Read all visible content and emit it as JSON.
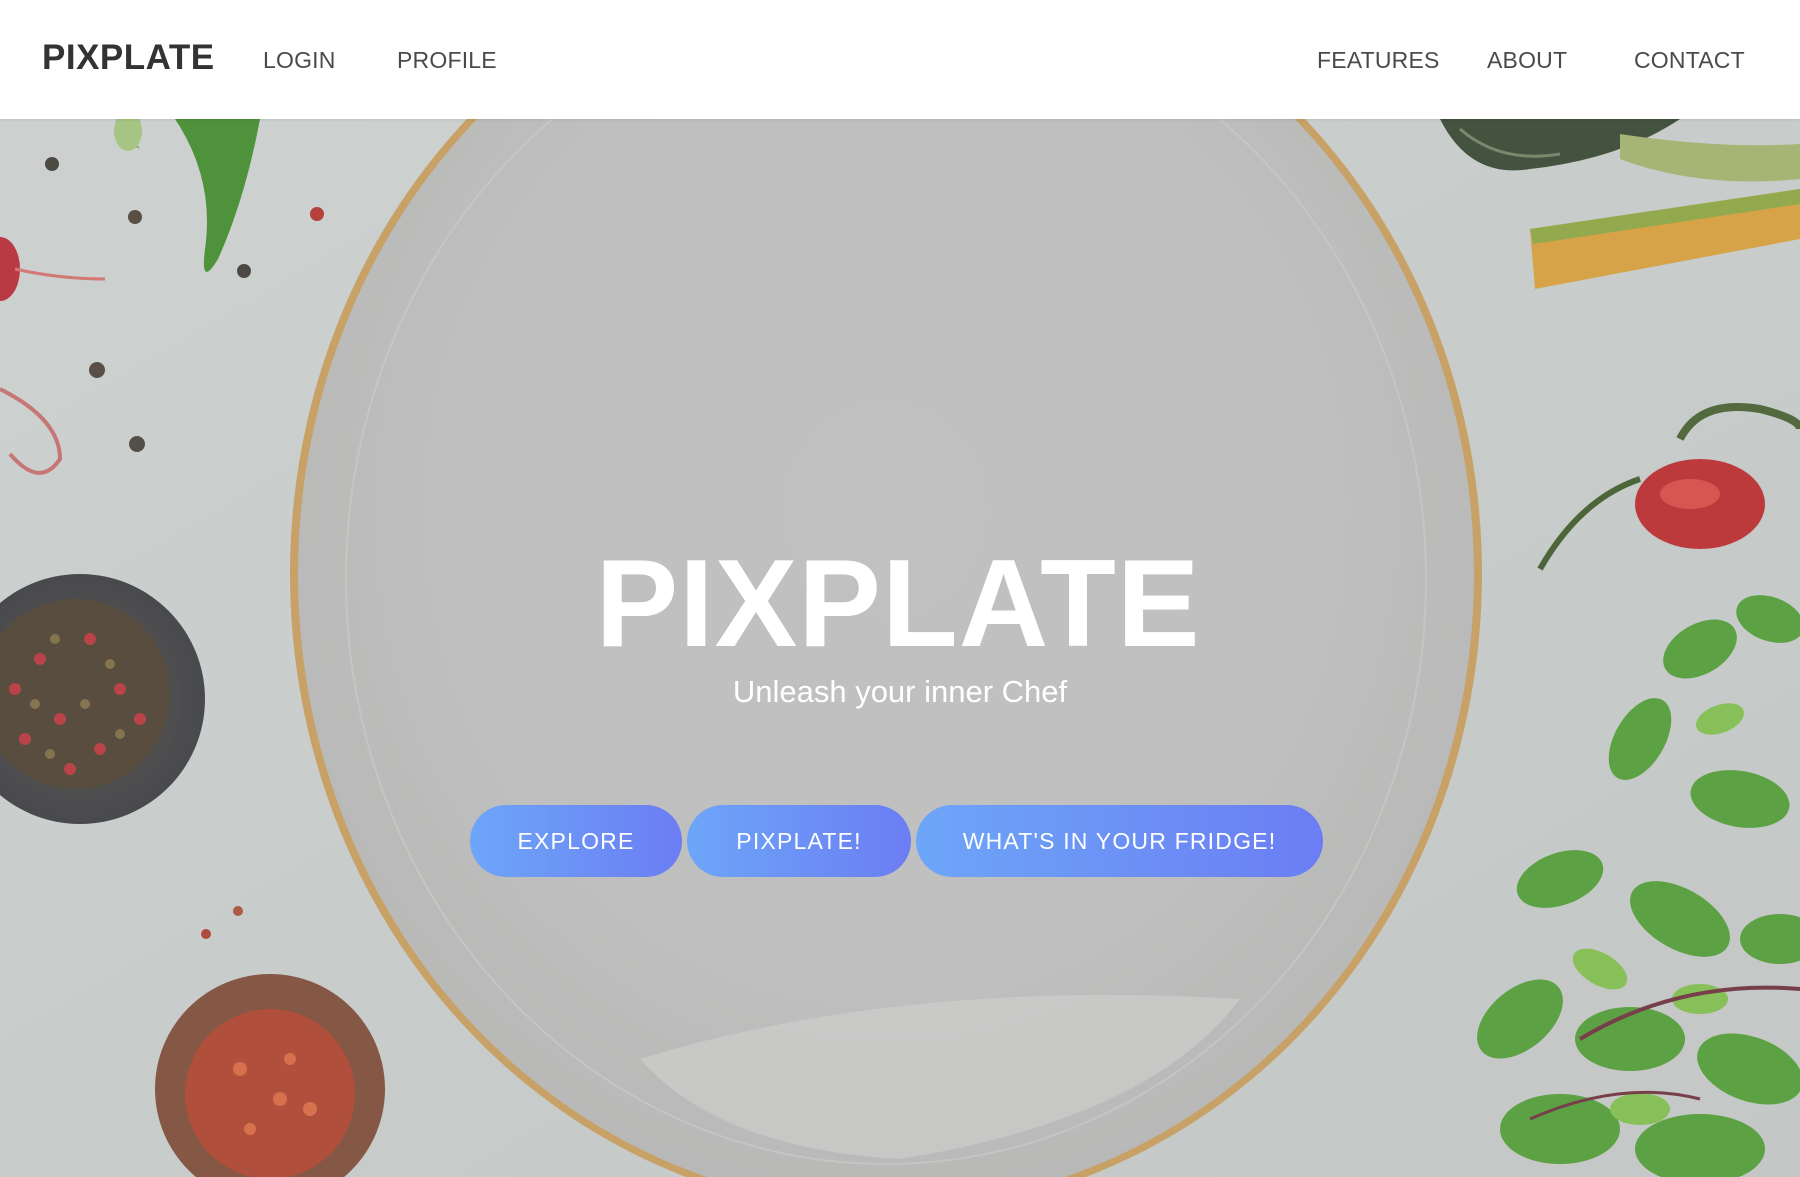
{
  "navbar": {
    "brand": "PIXPLATE",
    "left_links": [
      "LOGIN",
      "PROFILE"
    ],
    "right_links": [
      "FEATURES",
      "ABOUT",
      "CONTACT"
    ]
  },
  "hero": {
    "title": "PIXPLATE",
    "subtitle": "Unleash your inner Chef",
    "buttons": [
      "EXPLORE",
      "PIXPLATE!",
      "WHAT'S IN YOUR FRIDGE!"
    ]
  },
  "colors": {
    "button_gradient_start": "#6da6f8",
    "button_gradient_end": "#6b7df3",
    "nav_text": "#4a4a4a",
    "brand_text": "#333333",
    "hero_text": "#ffffff"
  }
}
